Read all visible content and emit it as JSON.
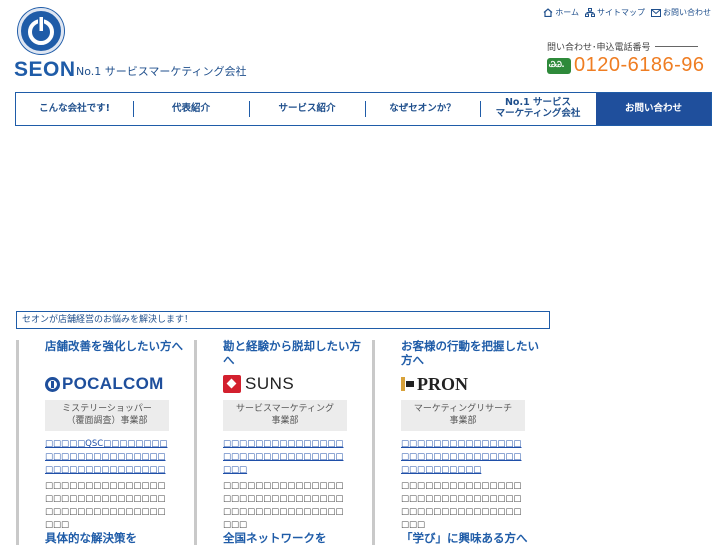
{
  "brand": {
    "name": "SEON",
    "tagline": "No.1 サービスマーケティング会社",
    "primary_color": "#1f5ca8",
    "accent_color": "#ef7d22"
  },
  "utility_nav": [
    {
      "label": "ホーム",
      "icon": "home-icon"
    },
    {
      "label": "サイトマップ",
      "icon": "sitemap-icon"
    },
    {
      "label": "お問い合わせ",
      "icon": "mail-icon"
    }
  ],
  "phone": {
    "label": "問い合わせ･申込電話番号",
    "free_dial_badge": "ᏊᏊ.",
    "number": "0120-6186-96"
  },
  "global_nav": [
    {
      "label": "こんな会社です!"
    },
    {
      "label": "代表紹介"
    },
    {
      "label": "サービス紹介"
    },
    {
      "label": "なぜセオンか？"
    },
    {
      "label": "No.1 サービス\nマーケティング会社"
    },
    {
      "label": "お問い合わせ"
    }
  ],
  "intro": "セオンが店舗経営のお悩みを解決します！",
  "services": [
    {
      "heading": "店舗改善を強化したい方へ",
      "logo_text": "POCALCOM",
      "dept": "ミステリーショッパー\n（覆面調査）事業部",
      "link": "□□□□□QSC□□□□□□□□□□□□□□□□□□□□□□□□□□□□□□□□□□□□□□",
      "desc": "□□□□□□□□□□□□□□□□□□□□□□□□□□□□□□□□□□□□□□□□□□□□□□□□"
    },
    {
      "heading": "勘と経験から脱却したい方へ",
      "logo_text": "SUNS",
      "dept": "サービスマーケティング\n事業部",
      "link": "□□□□□□□□□□□□□□□□□□□□□□□□□□□□□□□□□",
      "desc": "□□□□□□□□□□□□□□□□□□□□□□□□□□□□□□□□□□□□□□□□□□□□□□□□"
    },
    {
      "heading": "お客様の行動を把握したい方へ",
      "logo_text": "PRON",
      "dept": "マーケティングリサーチ\n事業部",
      "link": "□□□□□□□□□□□□□□□□□□□□□□□□□□□□□□□□□□□□□□□□",
      "desc": "□□□□□□□□□□□□□□□□□□□□□□□□□□□□□□□□□□□□□□□□□□□□□□□□"
    }
  ],
  "services_row2": [
    {
      "heading": "具体的な解決策を"
    },
    {
      "heading": "全国ネットワークを"
    },
    {
      "heading": "「学び」に興味ある方へ"
    }
  ]
}
